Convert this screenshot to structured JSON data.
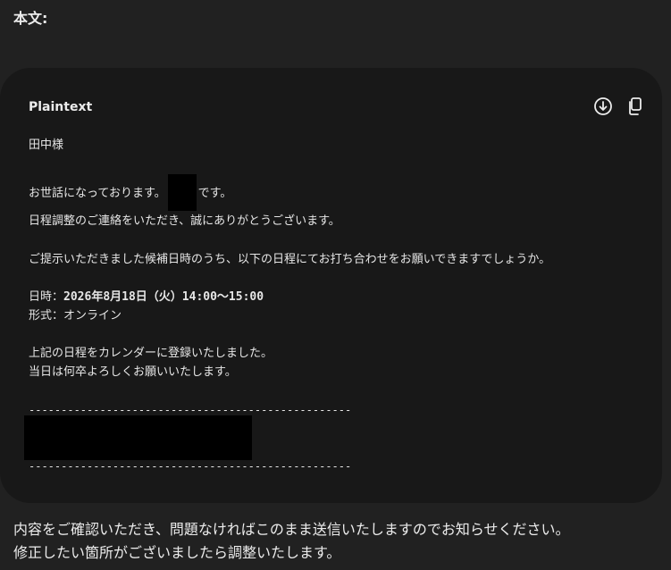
{
  "heading": "本文:",
  "code_block": {
    "language": "Plaintext",
    "download_icon": "download-circle-icon",
    "copy_icon": "copy-icon",
    "lines": {
      "greeting_name": "田中様",
      "intro_before": "お世話になっております。",
      "intro_after": "です。",
      "thanks": "日程調整のご連絡をいただき、誠にありがとうございます。",
      "proposal": "ご提示いただきました候補日時のうち、以下の日程にてお打ち合わせをお願いできますでしょうか。",
      "datetime_label": "日時：",
      "datetime_value": "2026年8月18日（火）14:00〜15:00",
      "format_label": "形式：",
      "format_value": "オンライン",
      "registered": "上記の日程をカレンダーに登録いたしました。",
      "closing": "当日は何卒よろしくお願いいたします。",
      "separator_top": "--------------------------------------------------",
      "separator_bottom": "--------------------------------------------------"
    }
  },
  "footer": {
    "line1": "内容をご確認いただき、問題なければこのまま送信いたしますのでお知らせください。",
    "line2": "修正したい箇所がございましたら調整いたします。"
  },
  "colors": {
    "background": "#212121",
    "card": "#181818",
    "text": "#ececec",
    "redaction": "#000000"
  }
}
